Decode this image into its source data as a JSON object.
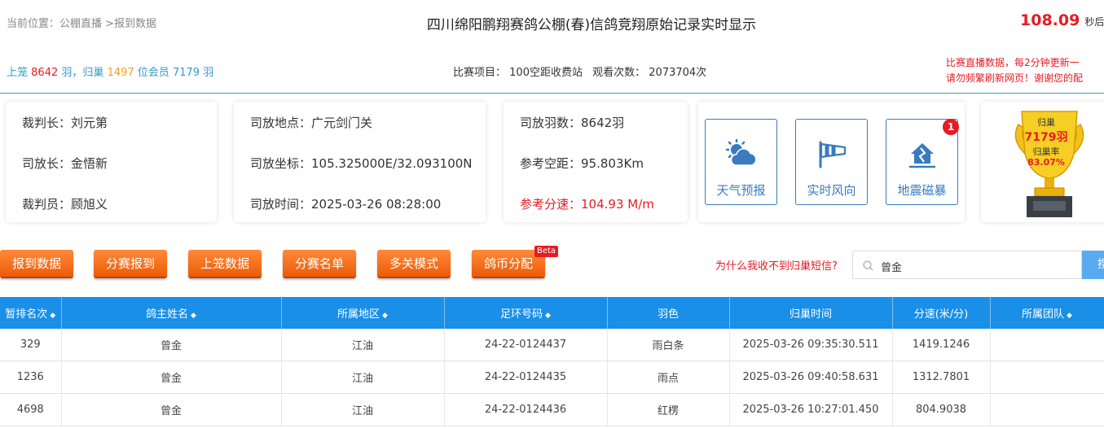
{
  "header": {
    "breadcrumb": "当前位置：公棚直播 >报到数据",
    "title": "四川绵阳鹏翔赛鸽公棚(春)信鸽竞翔原始记录实时显示",
    "timer_value": "108.09",
    "timer_unit": "秒后"
  },
  "stats": {
    "label_shanglong": "上笼",
    "shanglong": "8642",
    "unit1": "羽，",
    "label_guichao": "归巢",
    "guichao": "1497",
    "label_members": "位会员",
    "members": "7179",
    "unit2": "羽"
  },
  "race_info": {
    "project_label": "比赛项目：",
    "project": "100空距收费站",
    "views_label": "观看次数：",
    "views": "2073704次"
  },
  "notice": {
    "line1": "比赛直播数据，每2分钟更新一",
    "line2": "请勿频繁刷新网页！谢谢您的配"
  },
  "officials": {
    "chief_judge": "裁判长：刘元第",
    "release_chief": "司放长：金悟新",
    "judge": "裁判员：顾旭义"
  },
  "release": {
    "location": "司放地点：广元剑门关",
    "coords": "司放坐标：105.325000E/32.093100N",
    "time": "司放时间：2025-03-26 08:28:00"
  },
  "distance": {
    "count": "司放羽数：8642羽",
    "ref_distance": "参考空距：95.803Km",
    "ref_speed": "参考分速：104.93 M/m"
  },
  "tools": [
    {
      "label": "天气预报",
      "icon": "weather-icon"
    },
    {
      "label": "实时风向",
      "icon": "windsock-icon"
    },
    {
      "label": "地震磁暴",
      "icon": "earthquake-icon",
      "badge": "1"
    }
  ],
  "trophy": {
    "line1": "归巢",
    "line2": "7179羽",
    "line3": "归巢率",
    "line4": "83.07%"
  },
  "actions": [
    "报到数据",
    "分赛报到",
    "上笼数据",
    "分赛名单",
    "多关模式",
    "鸽币分配"
  ],
  "beta_label": "Beta",
  "why_link": "为什么我收不到归巢短信?",
  "search": {
    "value": "曾金",
    "button": "搜"
  },
  "table": {
    "headers": [
      "暂排名次",
      "鸽主姓名",
      "所属地区",
      "足环号码",
      "羽色",
      "归巢时间",
      "分速(米/分)",
      "所属团队"
    ],
    "sort_marker": "◆",
    "rows": [
      [
        "329",
        "曾金",
        "江油",
        "24-22-0124437",
        "雨白条",
        "2025-03-26 09:35:30.511",
        "1419.1246",
        ""
      ],
      [
        "1236",
        "曾金",
        "江油",
        "24-22-0124435",
        "雨点",
        "2025-03-26 09:40:58.631",
        "1312.7801",
        ""
      ],
      [
        "4698",
        "曾金",
        "江油",
        "24-22-0124436",
        "红楞",
        "2025-03-26 10:27:01.450",
        "804.9038",
        ""
      ]
    ]
  },
  "colors": {
    "accent_blue": "#1a8fe8",
    "orange_button": "#ec5b07",
    "alert_red": "#e51c23",
    "count_orange": "#f0a020",
    "link_blue": "#3399cc"
  }
}
